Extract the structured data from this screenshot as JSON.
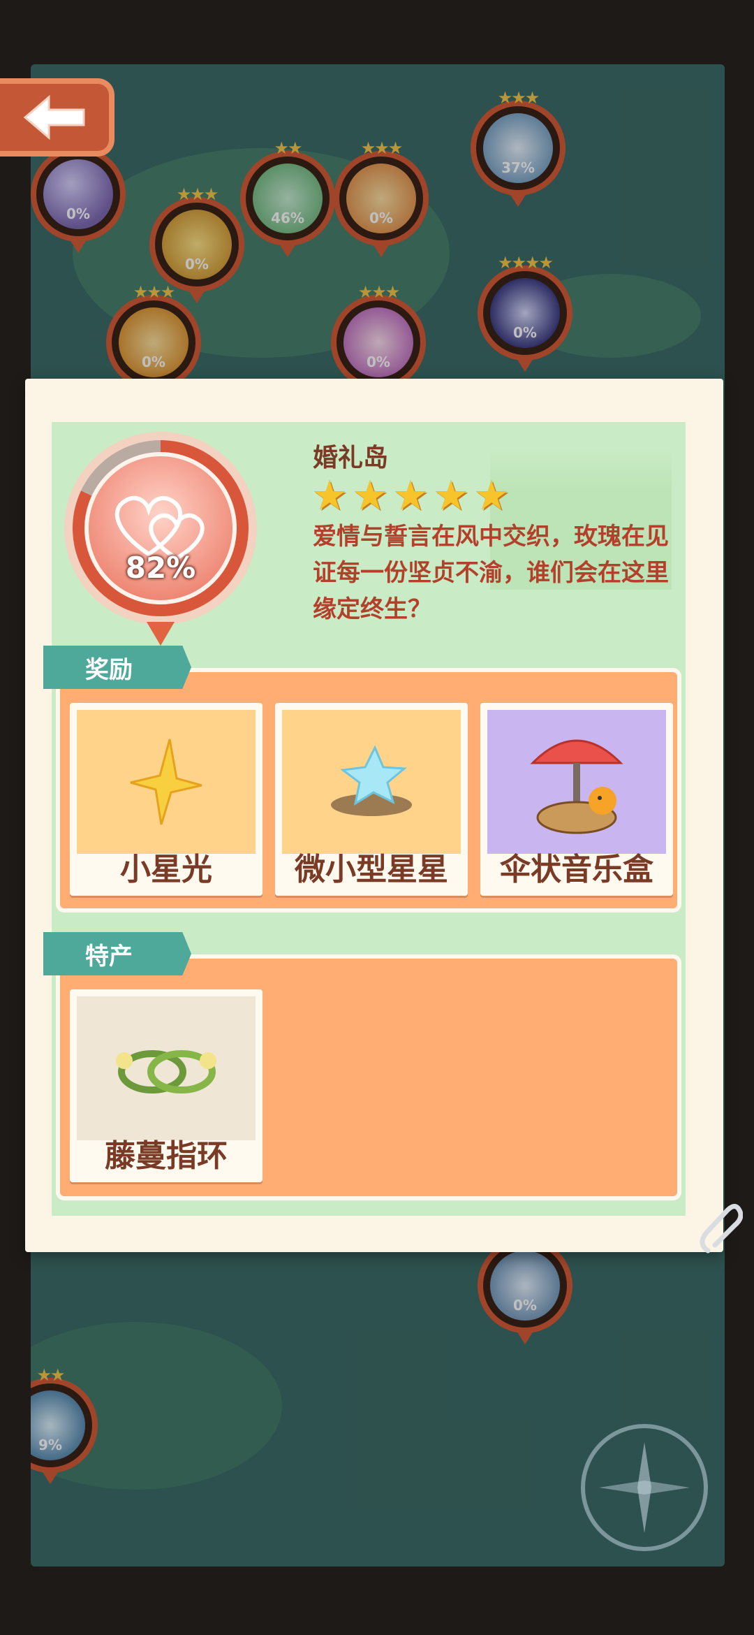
{
  "map_nodes": [
    {
      "id": "n1",
      "percent": "0%",
      "stars": "★★"
    },
    {
      "id": "n2",
      "percent": "0%",
      "stars": "★★★"
    },
    {
      "id": "n3",
      "percent": "46%",
      "stars": "★★"
    },
    {
      "id": "n4",
      "percent": "0%",
      "stars": "★★★"
    },
    {
      "id": "n5",
      "percent": "37%",
      "stars": "★★★"
    },
    {
      "id": "n6",
      "percent": "0%",
      "stars": "★★★★"
    },
    {
      "id": "n7",
      "percent": "0%",
      "stars": "★★★"
    },
    {
      "id": "n8",
      "percent": "0%",
      "stars": "★★★"
    },
    {
      "id": "n9",
      "percent": "9%",
      "stars": "★★"
    }
  ],
  "island": {
    "name": "婚礼岛",
    "progress": "82%",
    "star_count": 5,
    "description": "爱情与誓言在风中交织，玫瑰在见证每一份坚贞不渝，谁们会在这里缘定终生？"
  },
  "rewards": {
    "tab_label": "奖励",
    "items": [
      {
        "label": "小星光",
        "bg": "#ffd48a"
      },
      {
        "label": "微小型星星",
        "bg": "#ffd48a"
      },
      {
        "label": "伞状音乐盒",
        "bg": "#c9b5ef"
      }
    ]
  },
  "specialty": {
    "tab_label": "特产",
    "items": [
      {
        "label": "藤蔓指环",
        "bg": "#efe6d6"
      }
    ]
  }
}
